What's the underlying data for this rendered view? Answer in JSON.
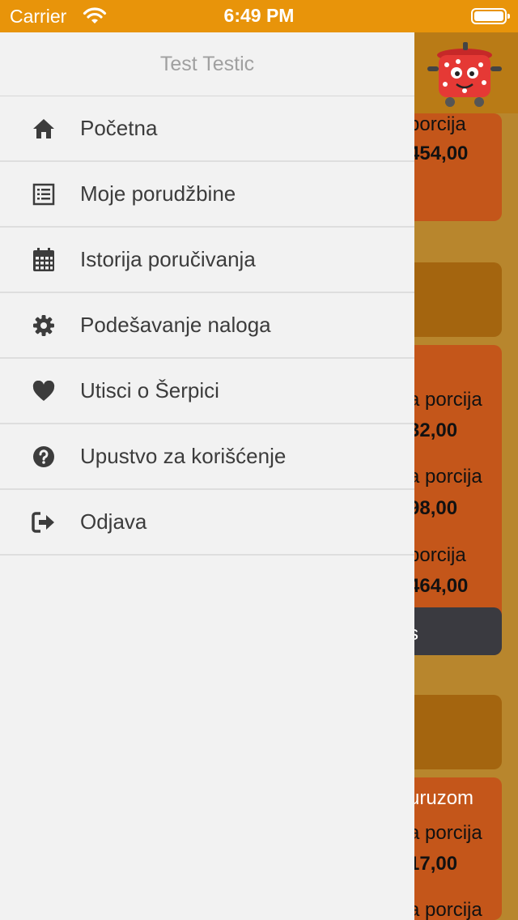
{
  "status_bar": {
    "carrier": "Carrier",
    "time": "6:49 PM"
  },
  "user": {
    "name": "Test Testic"
  },
  "menu": [
    {
      "label": "Početna",
      "icon": "home-icon"
    },
    {
      "label": "Moje porudžbine",
      "icon": "list-icon"
    },
    {
      "label": "Istorija poručivanja",
      "icon": "calendar-icon"
    },
    {
      "label": "Podešavanje naloga",
      "icon": "gear-icon"
    },
    {
      "label": "Utisci o Šerpici",
      "icon": "heart-icon"
    },
    {
      "label": "Upustvo za korišćenje",
      "icon": "help-icon"
    },
    {
      "label": "Odjava",
      "icon": "logout-icon"
    }
  ],
  "background": {
    "items": [
      {
        "label": "porcija",
        "price": "454,00"
      },
      {
        "label": "a porcija",
        "price": "32,00"
      },
      {
        "label": "a porcija",
        "price": "98,00"
      },
      {
        "label": "porcija",
        "price": "464,00"
      },
      {
        "label": "s"
      },
      {
        "label": "uruzom"
      },
      {
        "label": "a porcija",
        "price": "17,00"
      },
      {
        "label": "a porcija"
      }
    ]
  }
}
